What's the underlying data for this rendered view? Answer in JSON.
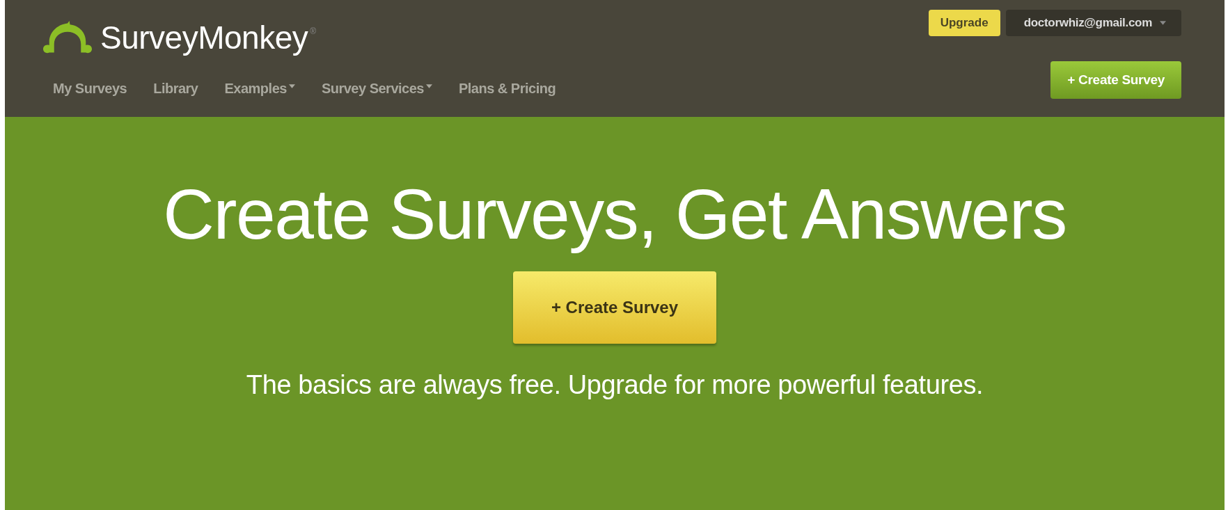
{
  "header": {
    "logo": "SurveyMonkey",
    "logo_mark": "®",
    "upgrade": "Upgrade",
    "account": {
      "email": "doctorwhiz@gmail.com",
      "dropdown": true
    },
    "create_button": "+ Create Survey",
    "nav": [
      {
        "label": "My Surveys",
        "dropdown": false
      },
      {
        "label": "Library",
        "dropdown": false
      },
      {
        "label": "Examples",
        "dropdown": true
      },
      {
        "label": "Survey Services",
        "dropdown": true
      },
      {
        "label": "Plans & Pricing",
        "dropdown": false
      }
    ]
  },
  "hero": {
    "title": "Create Surveys, Get Answers",
    "button": "+ Create Survey",
    "subtitle": "The basics are always free. Upgrade for more powerful features."
  }
}
